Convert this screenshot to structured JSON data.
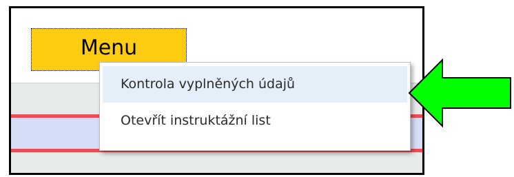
{
  "menu": {
    "button_label": "Menu",
    "items": [
      {
        "label": "Kontrola vyplněných údajů",
        "highlighted": true
      },
      {
        "label": "Otevřít instruktážní list",
        "highlighted": false
      }
    ]
  },
  "colors": {
    "menu_button": "#ffcc11",
    "highlight": "#e5effa",
    "arrow": "#00ff00",
    "row_border": "#ea4d55",
    "row_fill": "#d6ddf6"
  },
  "icons": {
    "pointer": "green-arrow-icon"
  }
}
